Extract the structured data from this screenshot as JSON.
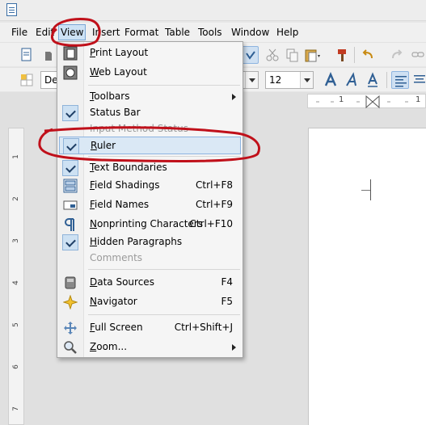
{
  "menubar": {
    "items": [
      "File",
      "Edit",
      "View",
      "Insert",
      "Format",
      "Table",
      "Tools",
      "Window",
      "Help"
    ],
    "active": "View"
  },
  "toolbar2": {
    "style_value": "De",
    "font_size_value": "12"
  },
  "ruler": {
    "h_mark": "1",
    "v_marks": [
      "1",
      "2",
      "3",
      "4",
      "5",
      "6",
      "7"
    ]
  },
  "view_menu": {
    "items": [
      {
        "label": "Print Layout",
        "icon": "print-layout-icon",
        "checked": false,
        "shortcut": "",
        "submenu": false,
        "disabled": false
      },
      {
        "label": "Web Layout",
        "icon": "web-layout-icon",
        "checked": false,
        "shortcut": "",
        "submenu": false,
        "disabled": false
      },
      {
        "label": "Toolbars",
        "icon": "",
        "checked": false,
        "shortcut": "",
        "submenu": true,
        "disabled": false
      },
      {
        "label": "Status Bar",
        "icon": "check-icon",
        "checked": true,
        "shortcut": "",
        "submenu": false,
        "disabled": false
      },
      {
        "label": "Input Method Status",
        "icon": "",
        "checked": false,
        "shortcut": "",
        "submenu": false,
        "disabled": true
      },
      {
        "label": "Ruler",
        "icon": "check-icon",
        "checked": true,
        "shortcut": "",
        "submenu": false,
        "disabled": false,
        "highlighted": true
      },
      {
        "label": "Text Boundaries",
        "icon": "check-icon",
        "checked": true,
        "shortcut": "",
        "submenu": false,
        "disabled": false
      },
      {
        "label": "Field Shadings",
        "icon": "field-shadings-icon",
        "checked": false,
        "shortcut": "Ctrl+F8",
        "submenu": false,
        "disabled": false
      },
      {
        "label": "Field Names",
        "icon": "field-names-icon",
        "checked": false,
        "shortcut": "Ctrl+F9",
        "submenu": false,
        "disabled": false
      },
      {
        "label": "Nonprinting Characters",
        "icon": "pilcrow-icon",
        "checked": false,
        "shortcut": "Ctrl+F10",
        "submenu": false,
        "disabled": false
      },
      {
        "label": "Hidden Paragraphs",
        "icon": "check-icon",
        "checked": true,
        "shortcut": "",
        "submenu": false,
        "disabled": false
      },
      {
        "label": "Comments",
        "icon": "",
        "checked": false,
        "shortcut": "",
        "submenu": false,
        "disabled": true
      },
      {
        "label": "Data Sources",
        "icon": "data-sources-icon",
        "checked": false,
        "shortcut": "F4",
        "submenu": false,
        "disabled": false
      },
      {
        "label": "Navigator",
        "icon": "navigator-icon",
        "checked": false,
        "shortcut": "F5",
        "submenu": false,
        "disabled": false
      },
      {
        "label": "Full Screen",
        "icon": "full-screen-icon",
        "checked": false,
        "shortcut": "Ctrl+Shift+J",
        "submenu": false,
        "disabled": false
      },
      {
        "label": "Zoom...",
        "icon": "zoom-icon",
        "checked": false,
        "shortcut": "",
        "submenu": true,
        "disabled": false
      }
    ]
  },
  "colors": {
    "annotation": "#c0101a",
    "highlight": "#dae8f5",
    "check_bg": "#cde1f3"
  }
}
